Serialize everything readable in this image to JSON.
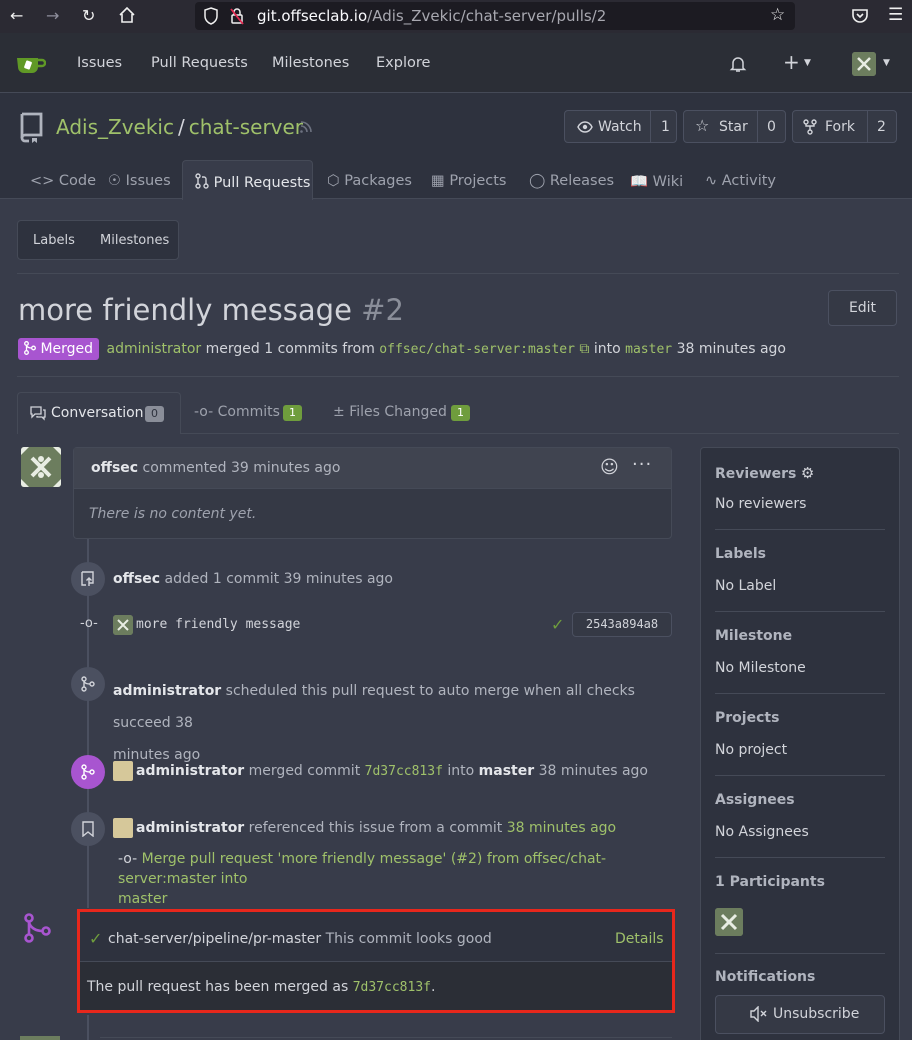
{
  "browser": {
    "url_host": "git.offseclab.io",
    "url_path": "/Adis_Zvekic/chat-server/pulls/2"
  },
  "nav": {
    "issues": "Issues",
    "pull_requests": "Pull Requests",
    "milestones": "Milestones",
    "explore": "Explore",
    "plus": "+"
  },
  "repo": {
    "owner": "Adis_Zvekic",
    "sep": "/",
    "name": "chat-server",
    "watch_label": "Watch",
    "watch_count": "1",
    "star_label": "Star",
    "star_count": "0",
    "fork_label": "Fork",
    "fork_count": "2",
    "tabs": [
      "Code",
      "Issues",
      "Pull Requests",
      "Packages",
      "Projects",
      "Releases",
      "Wiki",
      "Activity"
    ]
  },
  "filters": {
    "labels": "Labels",
    "milestones": "Milestones"
  },
  "pr": {
    "title": "more friendly message",
    "number": "#2",
    "edit_label": "Edit",
    "status": "Merged",
    "merger": "administrator",
    "merged_text": "merged 1 commits from",
    "head_branch": "offsec/chat-server:master",
    "into_text": "into",
    "base_branch": "master",
    "time": "38 minutes ago"
  },
  "pr_tabs": {
    "conversation": "Conversation",
    "conversation_count": "0",
    "commits": "Commits",
    "commits_count": "1",
    "files": "Files Changed",
    "files_count": "1"
  },
  "comment": {
    "author": "offsec",
    "action": "commented 39 minutes ago",
    "body": "There is no content yet."
  },
  "timeline": {
    "e1_author": "offsec",
    "e1_text": "added 1 commit 39 minutes ago",
    "commit_msg": "more friendly message",
    "commit_sha": "2543a894a8",
    "e2_author": "administrator",
    "e2_text_line1": "scheduled this pull request to auto merge when all checks succeed 38",
    "e2_text_line2": "minutes ago",
    "e3_author": "administrator",
    "e3_text1": "merged commit",
    "e3_sha": "7d37cc813f",
    "e3_text2": "into",
    "e3_branch": "master",
    "e3_time": "38 minutes ago",
    "e4_author": "administrator",
    "e4_text": "referenced this issue from a commit",
    "e4_time": "38 minutes ago",
    "e4_commit_line1": "Merge pull request 'more friendly message' (#2) from offsec/chat-server:master into",
    "e4_commit_line2": "master"
  },
  "merge_box": {
    "check_name": "chat-server/pipeline/pr-master",
    "check_status": "This commit looks good",
    "details": "Details",
    "merged_text": "The pull request has been merged as",
    "merged_sha": "7d37cc813f",
    "period": ".",
    "highlight_color": "#e8271c"
  },
  "sidebar": {
    "reviewers": "Reviewers",
    "reviewers_value": "No reviewers",
    "labels": "Labels",
    "labels_value": "No Label",
    "milestone": "Milestone",
    "milestone_value": "No Milestone",
    "projects": "Projects",
    "projects_value": "No project",
    "assignees": "Assignees",
    "assignees_value": "No Assignees",
    "participants": "1 Participants",
    "notifications": "Notifications",
    "unsubscribe": "Unsubscribe"
  }
}
